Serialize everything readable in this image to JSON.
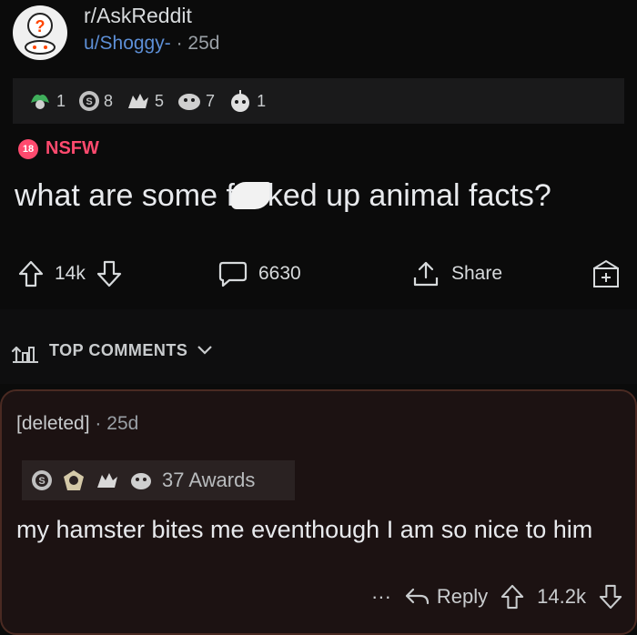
{
  "post": {
    "subreddit": "r/AskReddit",
    "user": "u/Shoggy-",
    "separator": "·",
    "age": "25d",
    "awards": [
      {
        "icon": "helpful-award-icon",
        "count": "1",
        "color": "#3fae5b"
      },
      {
        "icon": "silver-award-icon",
        "count": "8",
        "color": "#c0c0c0"
      },
      {
        "icon": "wholesome-award-icon",
        "count": "5",
        "color": "#d9d9d9"
      },
      {
        "icon": "hug-award-icon",
        "count": "7",
        "color": "#cfcfcf"
      },
      {
        "icon": "rocket-award-icon",
        "count": "1",
        "color": "#e0e0e0"
      }
    ],
    "nsfw_badge": "18",
    "nsfw_label": "NSFW",
    "title_before": "what are some f",
    "title_after": "ked up animal facts?",
    "upvotes": "14k",
    "comments": "6630",
    "share_label": "Share"
  },
  "sort": {
    "label": "TOP COMMENTS"
  },
  "comment": {
    "author": "[deleted]",
    "separator": "·",
    "age": "25d",
    "awards_label": "37 Awards",
    "body": "my hamster bites me eventhough I am so nice to him",
    "more": "···",
    "reply_label": "Reply",
    "score": "14.2k"
  },
  "colors": {
    "nsfw": "#ff4a6e",
    "user_link": "#5d8fd6",
    "comment_border": "#4a2a22"
  }
}
